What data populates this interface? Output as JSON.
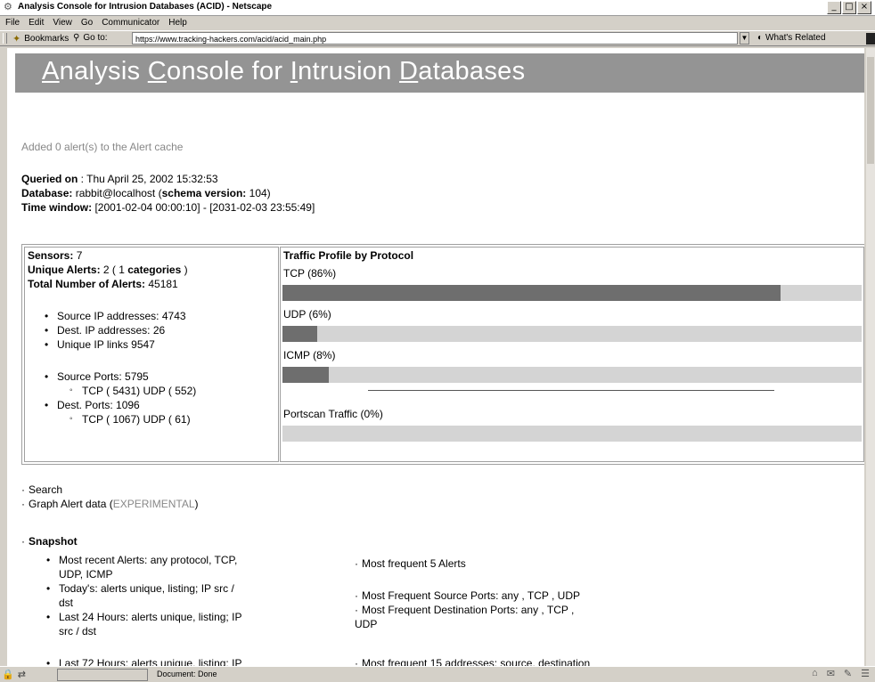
{
  "window": {
    "title": "Analysis Console for Intrusion Databases (ACID) - Netscape",
    "buttons": [
      "_",
      "□",
      "×"
    ]
  },
  "menu": [
    "File",
    "Edit",
    "View",
    "Go",
    "Communicator",
    "Help"
  ],
  "location": {
    "bookmarks": "Bookmarks",
    "goto_label": "Go to:",
    "url": "https://www.tracking-hackers.com/acid/acid_main.php",
    "whats_related": "What's Related"
  },
  "page": {
    "banner_title": [
      "Analysis ",
      "Console",
      " for ",
      "Intrusion",
      " ",
      "Databases"
    ],
    "banner_first": [
      "A",
      "nalysis ",
      "C",
      "onsole for ",
      "I",
      "ntrusion ",
      "D",
      "atabases"
    ],
    "cache_msg": "Added 0 alert(s) to the Alert cache",
    "queried_label": "Queried on",
    "queried_value": " : Thu April 25, 2002 15:32:53",
    "database_label": "Database:",
    "database_value": " rabbit@localhost   (",
    "schema_label": "schema version:",
    "schema_value": " 104)",
    "timewindow_label": "Time window:",
    "timewindow_value": " [2001-02-04 00:00:10] - [2031-02-03 23:55:49]"
  },
  "stats": {
    "sensors_label": "Sensors:",
    "sensors_value": " 7",
    "unique_label": "Unique Alerts:",
    "unique_value": " 2   (  1 ",
    "categories_label": "categories",
    "unique_close": "  )",
    "total_label": "Total Number of Alerts:",
    "total_value": " 45181",
    "src_ip": "Source IP addresses: 4743",
    "dst_ip": "Dest. IP addresses: 26",
    "unique_links": "Unique IP links 9547",
    "src_ports": "Source Ports: 5795",
    "src_ports_sub": "TCP ( 5431)  UDP ( 552)",
    "dst_ports": "Dest. Ports: 1096",
    "dst_ports_sub": "TCP ( 1067)  UDP ( 61)"
  },
  "profile": {
    "title": "Traffic Profile by Protocol",
    "rows": [
      {
        "label": "TCP (86%)",
        "percent": 86
      },
      {
        "label": "UDP (6%)",
        "percent": 6
      },
      {
        "label": "ICMP (8%)",
        "percent": 8
      }
    ],
    "portscan_label": "Portscan Traffic (0%)",
    "portscan_percent": 0,
    "colors": {
      "fill": "#6e6e6e",
      "track": "#d4d4d4"
    }
  },
  "links": {
    "search": "Search",
    "graph": "Graph Alert data",
    "graph_tag": "EXPERIMENTAL",
    "snapshot": "Snapshot"
  },
  "snapshot": {
    "left": [
      "Most recent Alerts: any protocol, TCP,",
      "UDP, ICMP",
      "Today's: alerts unique, listing; IP src /",
      "dst",
      "Last 24 Hours: alerts unique, listing; IP",
      "src / dst",
      "Last 72 Hours: alerts unique, listing; IP"
    ],
    "right": [
      "Most frequent 5 Alerts",
      "Most Frequent Source Ports: any , TCP , UDP",
      "Most Frequent Destination Ports: any , TCP ,",
      "UDP",
      "Most frequent 15 addresses: source, destination"
    ]
  },
  "status": {
    "text": "Document: Done"
  }
}
